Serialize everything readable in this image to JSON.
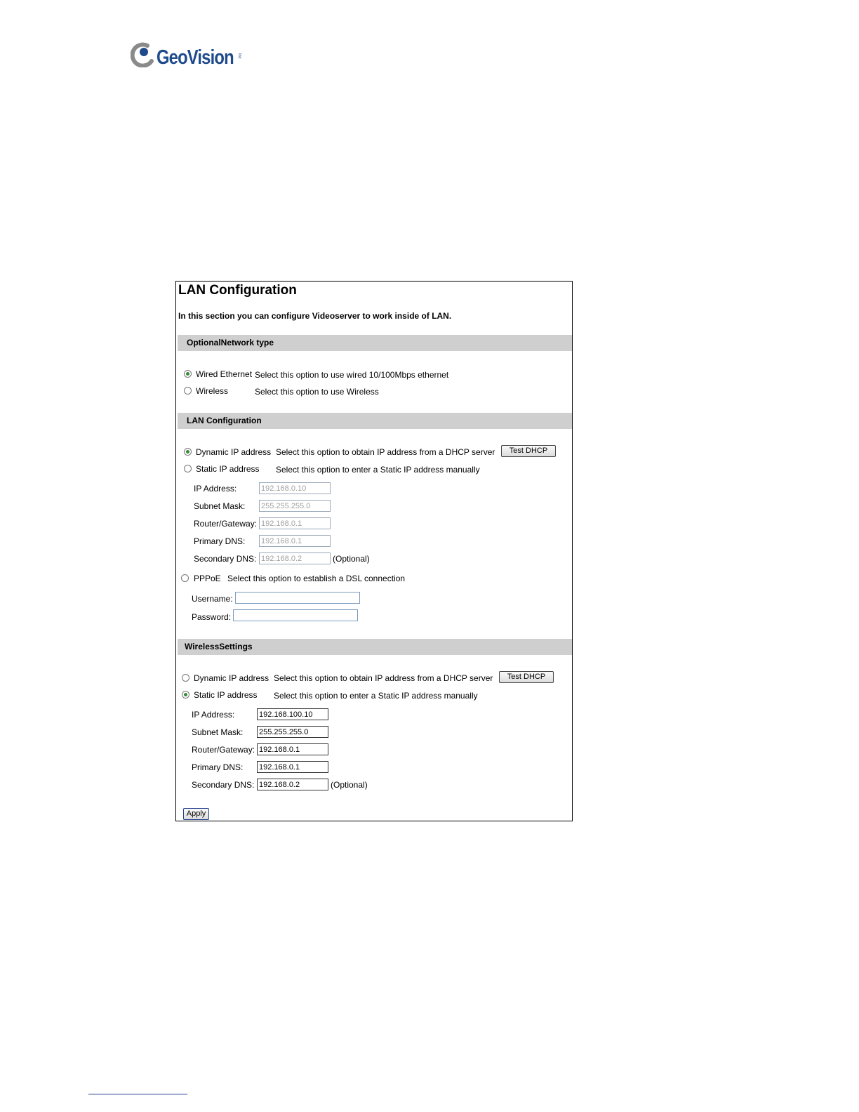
{
  "logo": {
    "text": "GeoVision",
    "suffix": "inc"
  },
  "panel": {
    "title": "LAN Configuration",
    "intro": "In this section you can configure Videoserver to work inside of LAN."
  },
  "network_type": {
    "header": "OptionalNetwork type",
    "wired": {
      "label": "Wired Ethernet",
      "desc": "Select this option to use wired 10/100Mbps ethernet",
      "selected": true
    },
    "wireless": {
      "label": "Wireless",
      "desc": "Select this option to use Wireless",
      "selected": false
    }
  },
  "lan": {
    "header": "LAN Configuration",
    "dynamic": {
      "label": "Dynamic IP address",
      "desc": "Select this option to obtain IP address from a DHCP server",
      "button": "Test DHCP"
    },
    "static": {
      "label": "Static IP address",
      "desc": "Select this option to enter a Static IP address manually"
    },
    "ip_label": "IP Address:",
    "ip_value": "192.168.0.10",
    "mask_label": "Subnet Mask:",
    "mask_value": "255.255.255.0",
    "gateway_label": "Router/Gateway:",
    "gateway_value": "192.168.0.1",
    "dns1_label": "Primary DNS:",
    "dns1_value": "192.168.0.1",
    "dns2_label": "Secondary DNS:",
    "dns2_value": "192.168.0.2",
    "optional": "(Optional)",
    "pppoe": {
      "label": "PPPoE",
      "desc": "Select this option to establish a DSL connection"
    },
    "username_label": "Username:",
    "username_value": "",
    "password_label": "Password:",
    "password_value": ""
  },
  "wireless": {
    "header": "WirelessSettings",
    "dynamic": {
      "label": "Dynamic IP address",
      "desc": "Select this option to obtain IP address from a DHCP server",
      "button": "Test DHCP"
    },
    "static": {
      "label": "Static IP address",
      "desc": "Select this option to enter a Static IP address manually"
    },
    "ip_label": "IP Address:",
    "ip_value": "192.168.100.10",
    "mask_label": "Subnet Mask:",
    "mask_value": "255.255.255.0",
    "gateway_label": "Router/Gateway:",
    "gateway_value": "192.168.0.1",
    "dns1_label": "Primary DNS:",
    "dns1_value": "192.168.0.1",
    "dns2_label": "Secondary DNS:",
    "dns2_value": "192.168.0.2",
    "optional": "(Optional)"
  },
  "apply_button": "Apply",
  "colors": {
    "brand": "#1f4a8c",
    "section_bg": "#cfcfcf",
    "radio_on": "#3a8a3a"
  }
}
